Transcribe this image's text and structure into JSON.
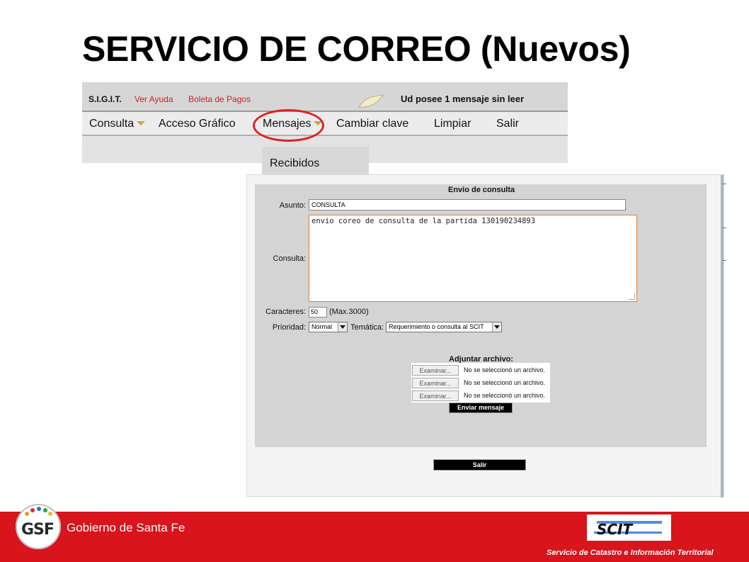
{
  "slide": {
    "title": "SERVICIO DE CORREO (Nuevos)"
  },
  "app": {
    "brand": "S.I.G.I.T.",
    "links": {
      "help": "Ver Ayuda",
      "payments": "Boleta de Pagos"
    },
    "unread_notice": "Ud posee 1 mensaje sin leer",
    "menu": [
      {
        "label": "Consulta",
        "has_dropdown": true
      },
      {
        "label": "Acceso Gráfico",
        "has_dropdown": false
      },
      {
        "label": "Mensajes",
        "has_dropdown": true
      },
      {
        "label": "Cambiar clave",
        "has_dropdown": false
      },
      {
        "label": "Limpiar",
        "has_dropdown": false
      },
      {
        "label": "Salir",
        "has_dropdown": false
      }
    ],
    "submenu": {
      "item": "Recibidos"
    },
    "highlight_color": "#e02020"
  },
  "form": {
    "title": "Envio de consulta",
    "subject_label": "Asunto:",
    "subject_value": "CONSULTA",
    "body_label": "Consulta:",
    "body_value": "envio coreo de consulta de la partida 130190234893",
    "chars_label": "Caracteres:",
    "chars_value": "50",
    "chars_max": "(Max.3000)",
    "priority_label": "Prioridad:",
    "priority_value": "Normal",
    "topic_label": "Temática:",
    "topic_value": "Requerimiento o consulta al SCIT",
    "attach_title": "Adjuntar archivo:",
    "attachments": [
      {
        "button": "Examinar...",
        "status": "No se seleccionó un archivo."
      },
      {
        "button": "Examinar...",
        "status": "No se seleccionó un archivo."
      },
      {
        "button": "Examinar...",
        "status": "No se seleccionó un archivo."
      }
    ],
    "send_label": "Enviar mensaje",
    "exit_label": "Salir"
  },
  "footer": {
    "logo_text": "GSF",
    "government": "Gobierno de Santa Fe",
    "scit_logo_text": "SCIT",
    "service_name": "Servicio de Catastro e Información Territorial",
    "bar_color": "#d8141c"
  }
}
